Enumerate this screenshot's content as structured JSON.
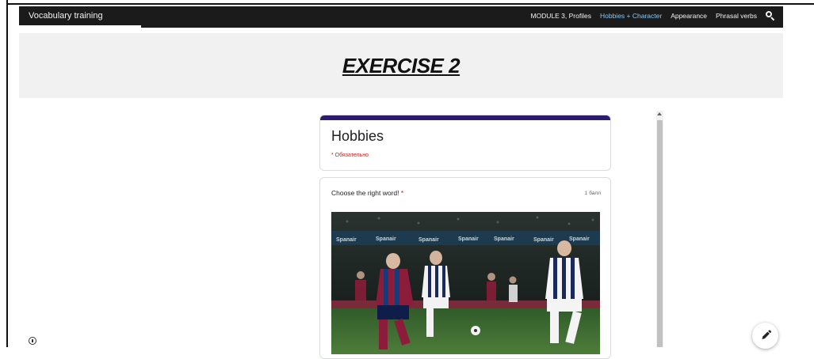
{
  "topbar": {
    "brand": "Vocabulary training",
    "nav": [
      {
        "label": "MODULE 3, Profiles",
        "active": false
      },
      {
        "label": "Hobbies + Character",
        "active": true
      },
      {
        "label": "Appearance",
        "active": false
      },
      {
        "label": "Phrasal verbs",
        "active": false
      }
    ],
    "search_icon": "search-icon"
  },
  "hero": {
    "title": "EXERCISE 2"
  },
  "form": {
    "title": "Hobbies",
    "required_note": "* Обязательно",
    "accent_color": "#2e1a6e",
    "question": {
      "text": "Choose the right word!",
      "required_mark": " *",
      "points": "1 балл",
      "image_description_icon": "football-match-photo"
    }
  },
  "footer": {
    "info_icon": "info-icon",
    "edit_icon": "pencil-icon"
  },
  "colors": {
    "topbar_bg": "#1b1b1b",
    "active_nav": "#8ec6f0",
    "hero_bg": "#f1f1f1",
    "required_red": "#c5221f"
  }
}
